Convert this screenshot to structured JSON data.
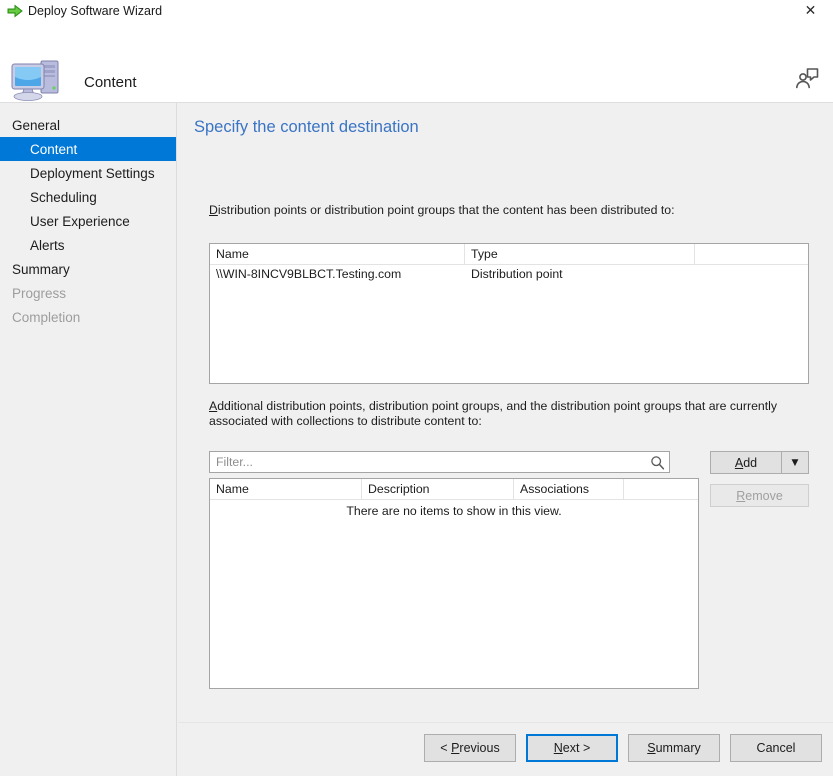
{
  "window": {
    "title": "Deploy Software Wizard",
    "title_icon": "green-arrow-icon",
    "close_label": "✕"
  },
  "header": {
    "title": "Content",
    "icon": "computer-icon",
    "help_icon": "feedback-person-icon"
  },
  "sidebar": {
    "items": [
      {
        "label": "General",
        "level": "top",
        "state": "normal"
      },
      {
        "label": "Content",
        "level": "sub",
        "state": "selected"
      },
      {
        "label": "Deployment Settings",
        "level": "sub",
        "state": "normal"
      },
      {
        "label": "Scheduling",
        "level": "sub",
        "state": "normal"
      },
      {
        "label": "User Experience",
        "level": "sub",
        "state": "normal"
      },
      {
        "label": "Alerts",
        "level": "sub",
        "state": "normal"
      },
      {
        "label": "Summary",
        "level": "top",
        "state": "normal"
      },
      {
        "label": "Progress",
        "level": "top",
        "state": "disabled"
      },
      {
        "label": "Completion",
        "level": "top",
        "state": "disabled"
      }
    ]
  },
  "main": {
    "heading": "Specify the content destination",
    "distributed_label_accel": "D",
    "distributed_label_rest": "istribution points or distribution point groups that the content has been distributed to:",
    "distributed_table": {
      "columns": [
        "Name",
        "Type",
        ""
      ],
      "rows": [
        {
          "name": "\\\\WIN-8INCV9BLBCT.Testing.com",
          "type": "Distribution point",
          "extra": ""
        }
      ]
    },
    "additional_label_line1_accel": "A",
    "additional_label_line1_rest": "dditional distribution points, distribution point groups, and the distribution point groups that are currently",
    "additional_label_line2": "associated with collections to distribute content to:",
    "filter": {
      "value": "",
      "placeholder": "Filter...",
      "icon": "search-icon"
    },
    "add_button": {
      "accel": "A",
      "rest": "dd",
      "arrow": "▼"
    },
    "remove_button": {
      "accel": "R",
      "rest": "emove",
      "disabled": true
    },
    "additional_table": {
      "columns": [
        "Name",
        "Description",
        "Associations",
        ""
      ],
      "empty_message": "There are no items to show in this view."
    }
  },
  "footer": {
    "buttons": [
      {
        "prefix": "< ",
        "accel": "P",
        "rest": "revious",
        "suffix": "",
        "default": false
      },
      {
        "prefix": "",
        "accel": "N",
        "rest": "ext",
        "suffix": " >",
        "default": true
      },
      {
        "prefix": "",
        "accel": "S",
        "rest": "ummary",
        "suffix": "",
        "default": false
      },
      {
        "prefix": "",
        "accel": "C",
        "rest": "ancel",
        "suffix": "",
        "default": false
      }
    ]
  },
  "colors": {
    "accent": "#0078d7",
    "heading": "#3a74c4",
    "panel": "#f0f0f0",
    "disabled_text": "#9d9d9d"
  }
}
